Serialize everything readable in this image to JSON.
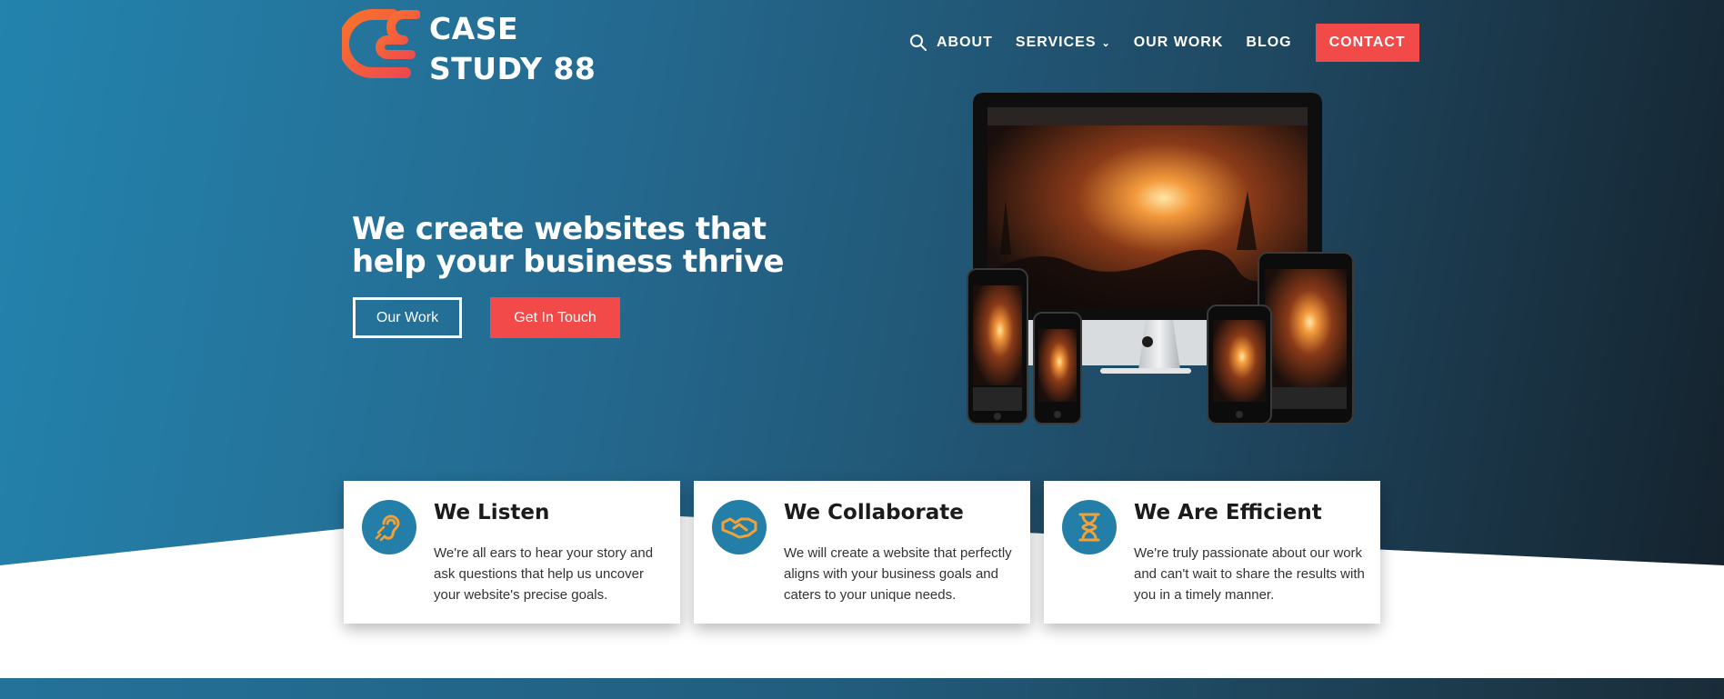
{
  "brand": {
    "line1": "CASE",
    "line2": "STUDY 88",
    "accent_color": "#f4622c"
  },
  "nav": {
    "search_icon": "search-icon",
    "items": [
      {
        "label": "ABOUT"
      },
      {
        "label": "SERVICES",
        "has_dropdown": true
      },
      {
        "label": "OUR WORK"
      },
      {
        "label": "BLOG"
      }
    ],
    "contact_label": "CONTACT"
  },
  "hero": {
    "headline": "We create websites that help your business thrive",
    "primary_button": "Our Work",
    "secondary_button": "Get In Touch",
    "illustration": "responsive-devices-mockup"
  },
  "features": [
    {
      "icon": "listening-ear-icon",
      "title": "We Listen",
      "text": "We're all ears to hear your story and ask questions that help us uncover your website's precise goals."
    },
    {
      "icon": "handshake-icon",
      "title": "We Collaborate",
      "text": "We will create a website that perfectly aligns with your business goals and caters to your unique needs."
    },
    {
      "icon": "hourglass-icon",
      "title": "We Are Efficient",
      "text": "We're truly passionate about our work and can't wait to share the results with you in a timely manner."
    }
  ],
  "colors": {
    "accent_red": "#f24a48",
    "icon_blue": "#237fa8",
    "icon_orange": "#f0a13a"
  }
}
